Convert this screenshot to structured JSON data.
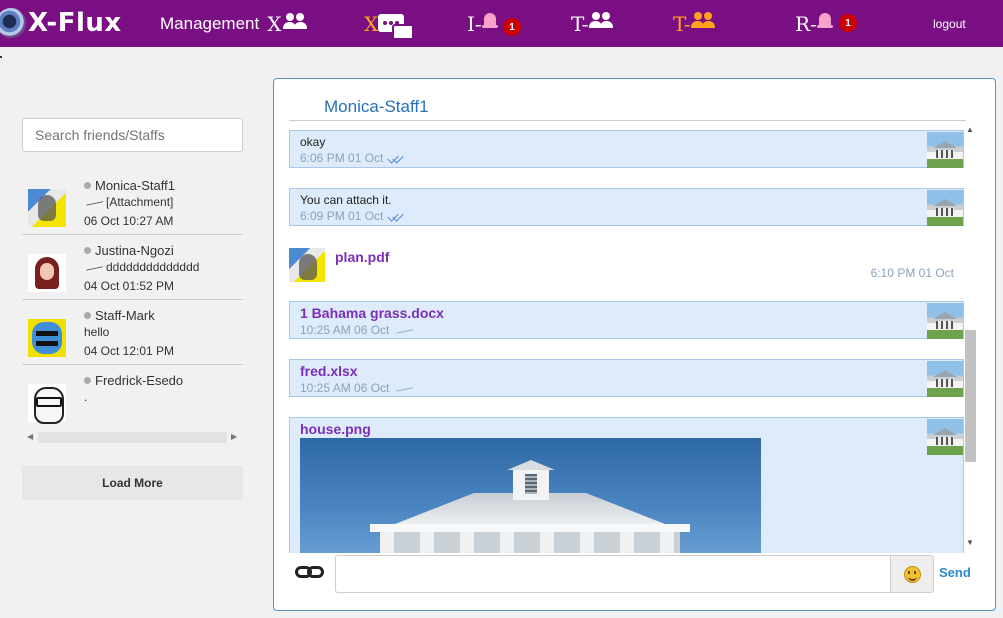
{
  "nav": {
    "logo_text": "X-Flux",
    "management_label": "Management",
    "management_x": "X",
    "x_chat_label": "X",
    "i_label": "I-",
    "i_badge": "1",
    "t_label": "T-",
    "t2_label": "T-",
    "r_label": "R-",
    "r_badge": "1",
    "logout_label": "logout"
  },
  "sidebar": {
    "search_placeholder": "Search friends/Staffs",
    "friends": [
      {
        "name": "Monica-Staff1",
        "last_message": "[Attachment]",
        "time": "06 Oct 10:27 AM",
        "avatar": "avatar-monica"
      },
      {
        "name": "Justina-Ngozi",
        "last_message": "dddddddddddddd",
        "time": "04 Oct 01:52 PM",
        "avatar": "avatar-justina"
      },
      {
        "name": "Staff-Mark",
        "last_message": "hello",
        "time": "04 Oct 12:01 PM",
        "avatar": "avatar-mark"
      },
      {
        "name": "Fredrick-Esedo",
        "last_message": ".",
        "time": "",
        "avatar": "avatar-fredrick"
      }
    ],
    "load_more_label": "Load More"
  },
  "chat": {
    "title": "Monica-Staff1",
    "messages": [
      {
        "text": "okay",
        "time": "6:06 PM 01 Oct"
      },
      {
        "text": "You can attach it.",
        "time": "6:09 PM 01 Oct"
      },
      {
        "file": "plan.pdf",
        "time": "6:10 PM 01 Oct"
      },
      {
        "file": "1 Bahama grass.docx",
        "time": "10:25 AM 06 Oct"
      },
      {
        "file": "fred.xlsx",
        "time": "10:25 AM 06 Oct"
      },
      {
        "file": "house.png"
      }
    ],
    "send_label": "Send"
  },
  "colors": {
    "nav_bg": "#7a0f84",
    "accent_orange": "#ffa31a",
    "outgoing_bg": "#deebfa",
    "file_link": "#7a2fb6",
    "title_blue": "#2a70b8",
    "badge_red": "#cc0000"
  }
}
